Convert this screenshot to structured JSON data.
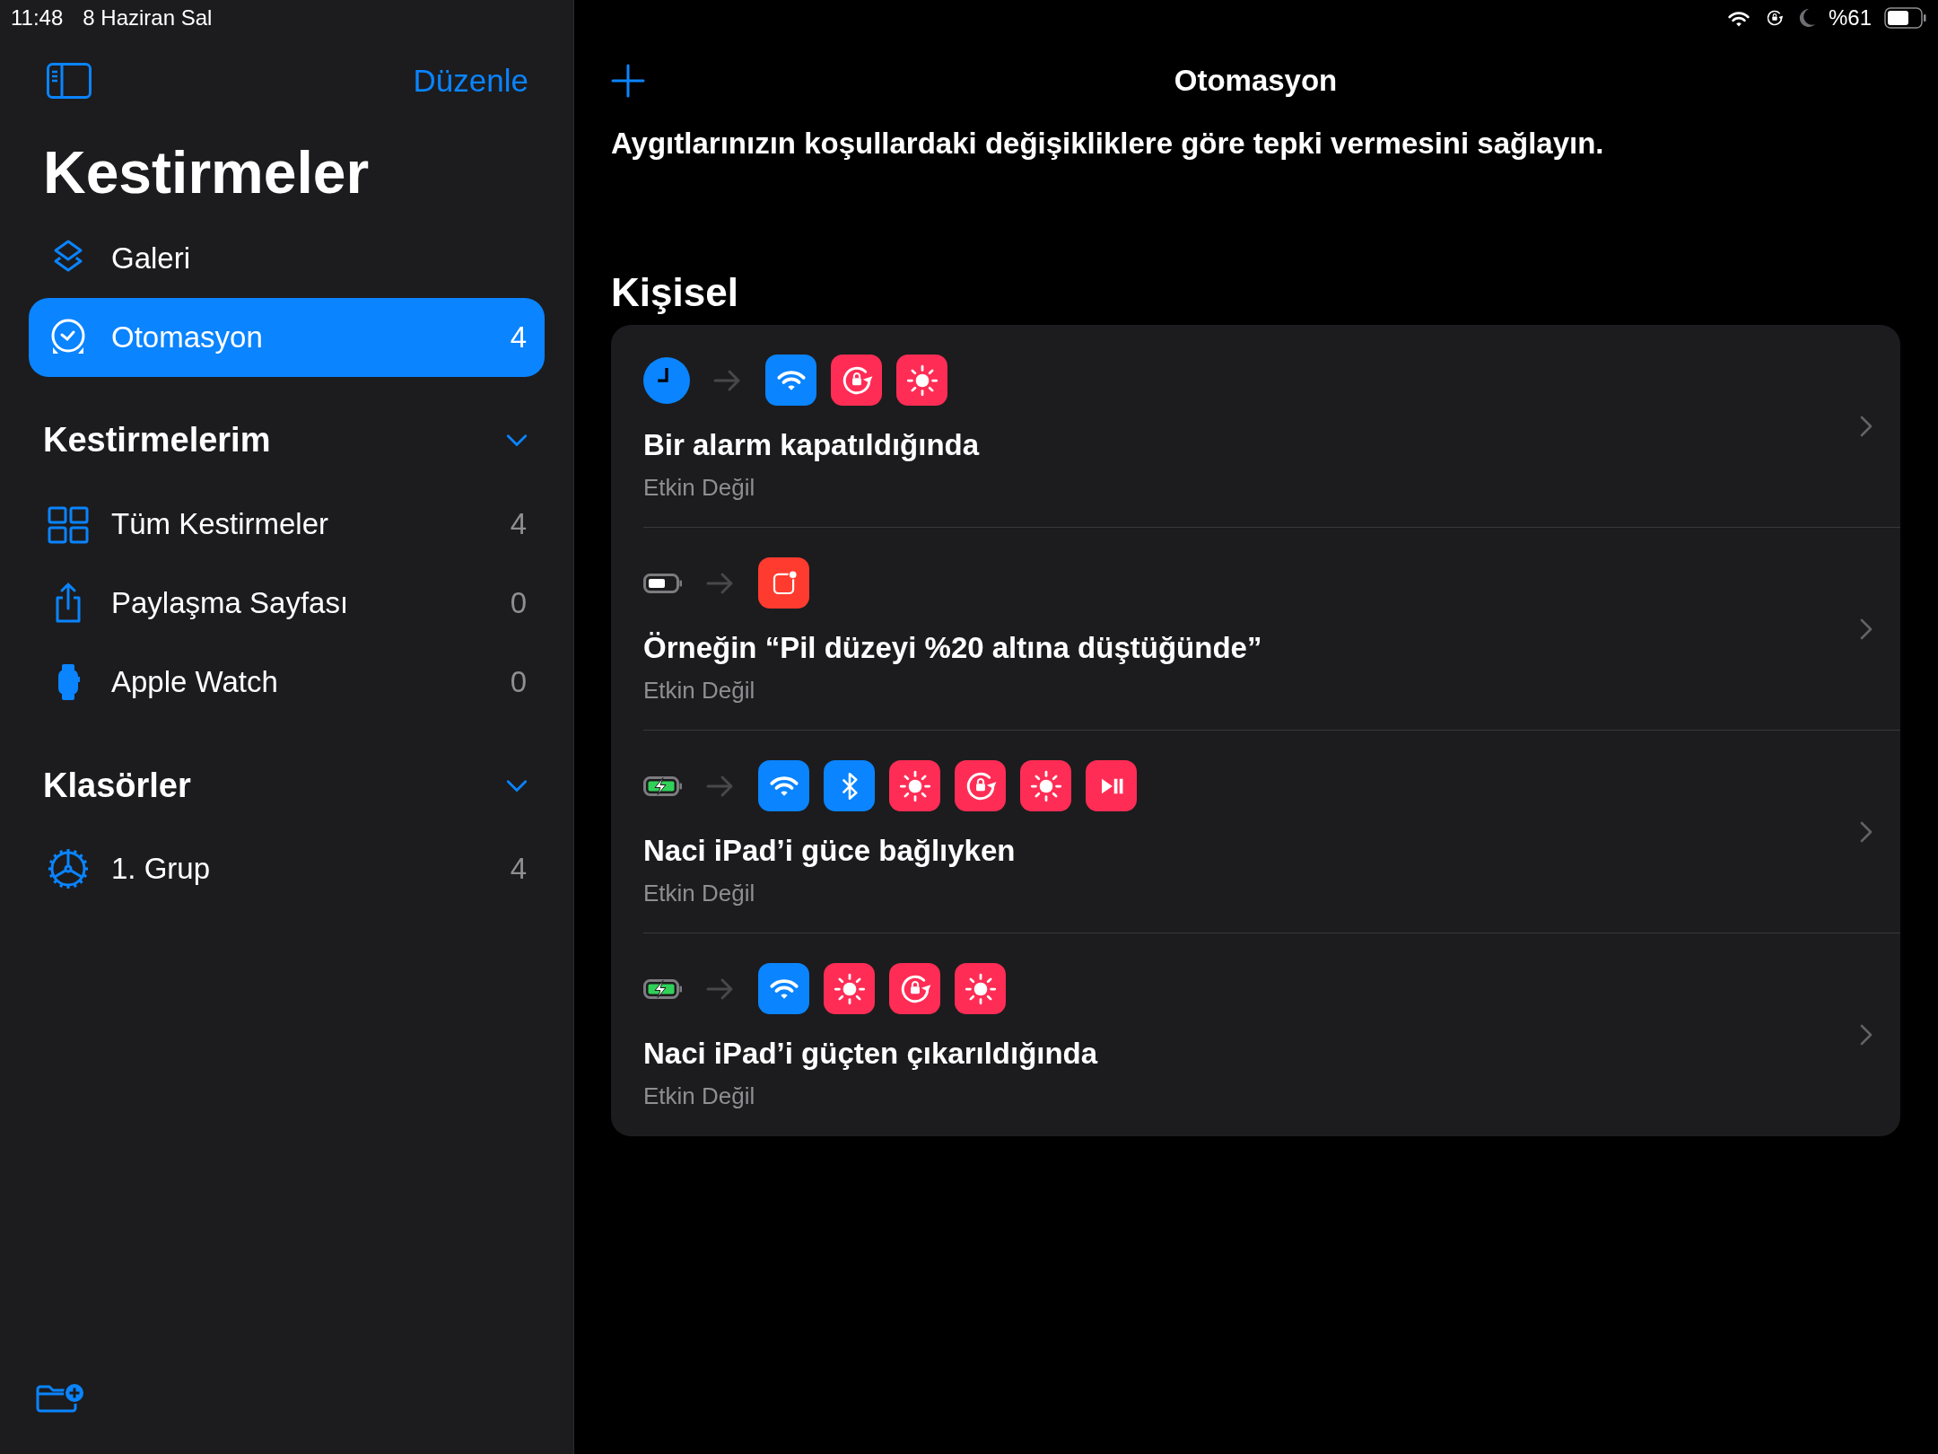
{
  "status_bar": {
    "time": "11:48",
    "date": "8 Haziran Sal",
    "battery": "%61"
  },
  "sidebar": {
    "edit_button": "Düzenle",
    "title": "Kestirmeler",
    "items": [
      {
        "kind": "gallery",
        "label": "Galeri",
        "selected": false
      },
      {
        "kind": "automation",
        "label": "Otomasyon",
        "count": "4",
        "selected": true
      }
    ],
    "sections": [
      {
        "title": "Kestirmelerim",
        "expanded": true,
        "items": [
          {
            "kind": "grid",
            "label": "Tüm Kestirmeler",
            "count": "4",
            "selected": false
          },
          {
            "kind": "share",
            "label": "Paylaşma Sayfası",
            "count": "0",
            "selected": false
          },
          {
            "kind": "watch",
            "label": "Apple Watch",
            "count": "0",
            "selected": false
          }
        ]
      },
      {
        "title": "Klasörler",
        "expanded": true,
        "items": [
          {
            "kind": "folder",
            "label": "1. Grup",
            "count": "4",
            "selected": false
          }
        ]
      }
    ]
  },
  "main": {
    "title": "Otomasyon",
    "description": "Aygıtlarınızın koşullardaki değişikliklere göre tepki vermesini sağlayın.",
    "section_title": "Kişisel",
    "automations": [
      {
        "trigger": {
          "kind": "alarm"
        },
        "actions": [
          {
            "kind": "wifi"
          },
          {
            "kind": "lock-rotation"
          },
          {
            "kind": "brightness"
          }
        ],
        "title": "Bir alarm kapatıldığında",
        "status": "Etkin Değil"
      },
      {
        "trigger": {
          "kind": "battery-low"
        },
        "actions": [
          {
            "kind": "notification"
          }
        ],
        "title": "Örneğin “Pil düzeyi %20 altına düştüğünde”",
        "status": "Etkin Değil"
      },
      {
        "trigger": {
          "kind": "battery-charging"
        },
        "actions": [
          {
            "kind": "wifi"
          },
          {
            "kind": "bluetooth"
          },
          {
            "kind": "brightness"
          },
          {
            "kind": "lock-rotation"
          },
          {
            "kind": "brightness"
          },
          {
            "kind": "play-pause"
          }
        ],
        "title": "Naci iPad’i güce bağlıyken",
        "status": "Etkin Değil"
      },
      {
        "trigger": {
          "kind": "battery-charging"
        },
        "actions": [
          {
            "kind": "wifi"
          },
          {
            "kind": "brightness"
          },
          {
            "kind": "lock-rotation"
          },
          {
            "kind": "brightness"
          }
        ],
        "title": "Naci iPad’i güçten çıkarıldığında",
        "status": "Etkin Değil"
      }
    ]
  }
}
